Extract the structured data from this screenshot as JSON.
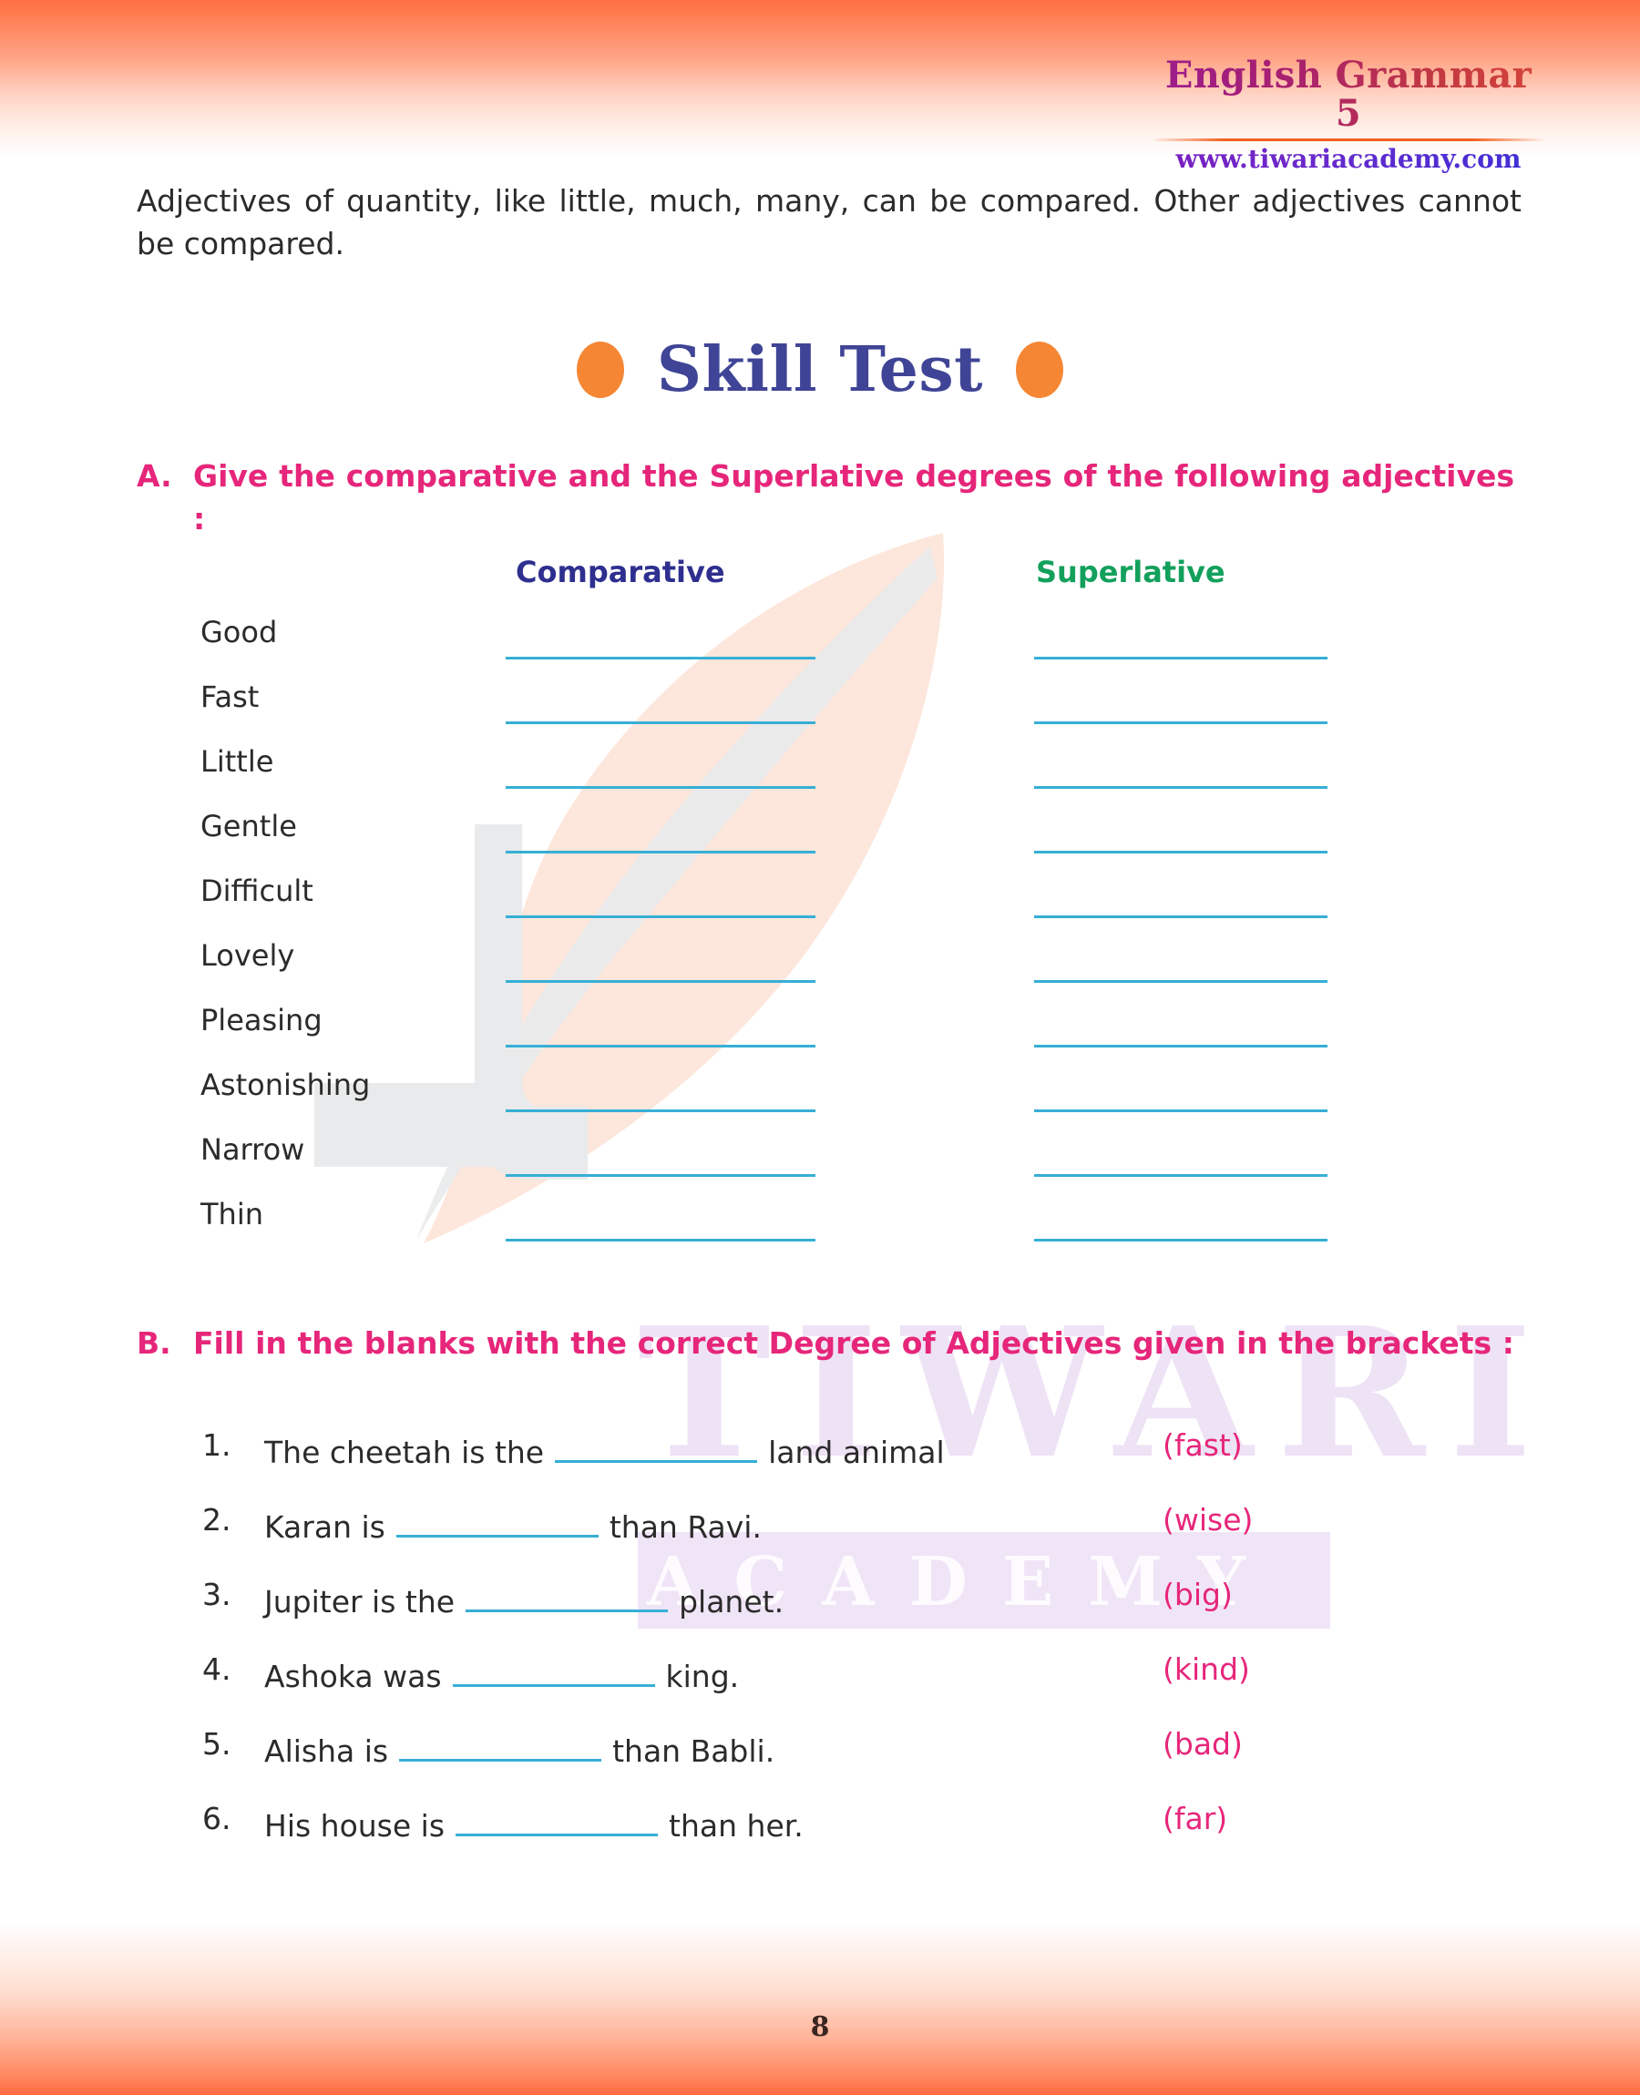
{
  "header": {
    "brand_title": "English Grammar 5",
    "brand_url": "www.tiwariacademy.com"
  },
  "intro": {
    "paragraph": "Adjectives of quantity, like little, much, many, can be compared. Other adjectives cannot be compared."
  },
  "skill_test": {
    "label": "Skill Test",
    "left_dot": "orange-dot-icon",
    "right_dot": "orange-dot-icon"
  },
  "section_a": {
    "letter": "A.",
    "heading": "Give the comparative and the Superlative degrees of the following adjectives :",
    "columns": {
      "comparative": "Comparative",
      "superlative": "Superlative"
    },
    "adjectives": [
      "Good",
      "Fast",
      "Little",
      "Gentle",
      "Difficult",
      "Lovely",
      "Pleasing",
      "Astonishing",
      "Narrow",
      "Thin"
    ]
  },
  "section_b": {
    "letter": "B.",
    "heading": "Fill in the blanks with the correct Degree of Adjectives given in the brackets :",
    "questions": [
      {
        "number": "1.",
        "before": "The cheetah is the",
        "blank_width": 222,
        "after": "land animal",
        "hint": "(fast)"
      },
      {
        "number": "2.",
        "before": "Karan is",
        "blank_width": 222,
        "after": "than Ravi.",
        "hint": "(wise)"
      },
      {
        "number": "3.",
        "before": "Jupiter is the",
        "blank_width": 222,
        "after": "planet.",
        "hint": "(big)"
      },
      {
        "number": "4.",
        "before": "Ashoka was",
        "blank_width": 222,
        "after": "king.",
        "hint": "(kind)"
      },
      {
        "number": "5.",
        "before": "Alisha is",
        "blank_width": 222,
        "after": "than Babli.",
        "hint": "(bad)"
      },
      {
        "number": "6.",
        "before": "His house is",
        "blank_width": 222,
        "after": "than her.",
        "hint": "(far)"
      }
    ]
  },
  "watermark": {
    "brand_line1": "TIWARI",
    "brand_line2": "ACADEMY",
    "feather": "feather-quill-icon"
  },
  "footer": {
    "page_number": "8"
  },
  "colors": {
    "heading_pink": "#E6267A",
    "comparative_blue": "#2E2F8F",
    "superlative_green": "#13A05C",
    "blank_line": "#36AFD6",
    "skill_test_navy": "#3F4496",
    "accent_orange": "#F58634",
    "body_text": "#2B2B2B"
  }
}
